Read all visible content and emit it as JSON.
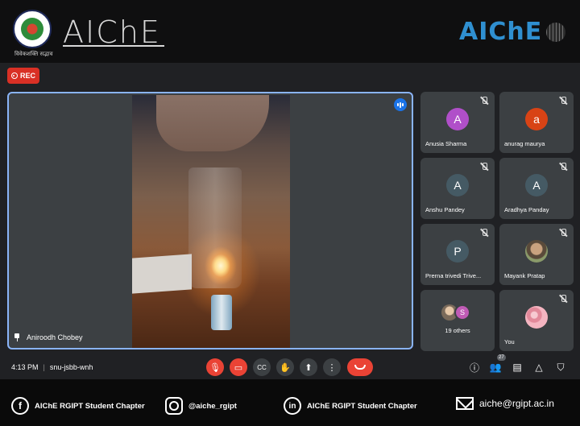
{
  "header": {
    "logo_tagline": "विवेकशक्ति सद्भाव",
    "brand_left": "AIChE",
    "brand_right": "AIChE"
  },
  "recording": {
    "label": "REC"
  },
  "main_speaker": {
    "name": "Aniroodh Chobey"
  },
  "participants": [
    {
      "name": "Anusia Sharma",
      "initial": "A",
      "color": "#b04fc9",
      "muted": true
    },
    {
      "name": "anurag maurya",
      "initial": "a",
      "color": "#d84315",
      "muted": true
    },
    {
      "name": "Anshu Pandey",
      "initial": "A",
      "color": "#455a64",
      "muted": true
    },
    {
      "name": "Aradhya Panday",
      "initial": "A",
      "color": "#455a64",
      "muted": true
    },
    {
      "name": "Prerna trivedi Trive...",
      "initial": "P",
      "color": "#455a64",
      "muted": true
    },
    {
      "name": "Mayank Pratap",
      "initial": "",
      "color": "",
      "muted": true
    }
  ],
  "others": {
    "label": "19 others",
    "initial": "S"
  },
  "self_tile": {
    "name": "You"
  },
  "meeting": {
    "time": "4:13 PM",
    "code": "snu-jsbb-wnh",
    "people_count": "27"
  },
  "controls": [
    "mic-off",
    "camera-off",
    "captions",
    "raise-hand",
    "present",
    "more",
    "leave-call"
  ],
  "footer": {
    "facebook": "AIChE RGIPT Student Chapter",
    "instagram": "@aiche_rgipt",
    "linkedin": "AIChE RGIPT Student Chapter",
    "email": "aiche@rgipt.ac.in"
  }
}
